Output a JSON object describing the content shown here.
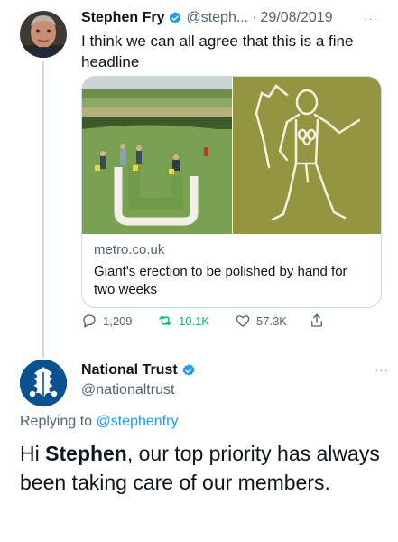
{
  "tweet1": {
    "author_name": "Stephen Fry",
    "handle": "@steph...",
    "separator": "·",
    "date": "29/08/2019",
    "more_label": "···",
    "text": "I think we can all agree that this is a fine headline",
    "card": {
      "domain": "metro.co.uk",
      "title": "Giant's erection to be polished by hand for two weeks"
    },
    "actions": {
      "replies": "1,209",
      "retweets": "10.1K",
      "likes": "57.3K"
    }
  },
  "tweet2": {
    "author_name": "National Trust",
    "handle": "@nationaltrust",
    "more_label": "···",
    "replying_prefix": "Replying to",
    "replying_to": "@stephenfry",
    "text_greeting": "Hi",
    "text_name": "Stephen",
    "text_rest": ", our top priority has always been taking care of our members."
  },
  "colors": {
    "verified_blue": "#1d9bf0",
    "retweet_green": "#00ba7c",
    "national_trust_blue": "#0a5190",
    "muted_text": "#536471"
  },
  "icons": [
    "verified-badge-icon",
    "reply-icon",
    "retweet-icon",
    "like-icon",
    "share-icon",
    "more-icon",
    "oak-leaf-logo"
  ]
}
